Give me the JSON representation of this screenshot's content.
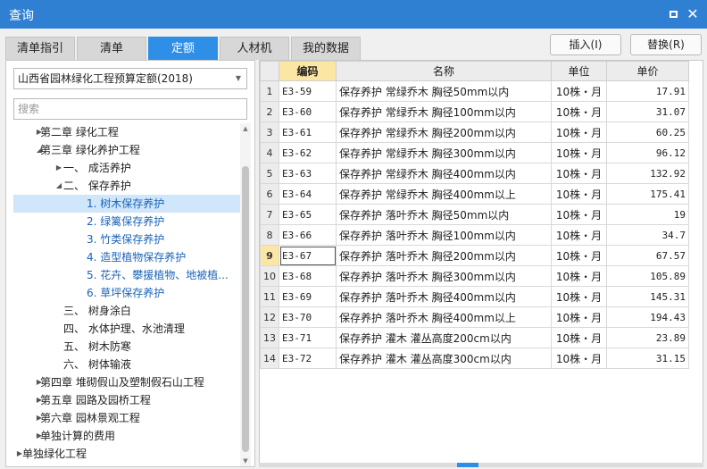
{
  "window": {
    "title": "查询",
    "minimize_icon": "restore-icon",
    "close_icon": "close-icon"
  },
  "tabs": [
    {
      "label": "清单指引"
    },
    {
      "label": "清单"
    },
    {
      "label": "定额"
    },
    {
      "label": "人材机"
    },
    {
      "label": "我的数据"
    }
  ],
  "active_tab": "定额",
  "actions": {
    "insert": "插入(I)",
    "replace": "替换(R)"
  },
  "left": {
    "library": "山西省园林绿化工程预算定额(2018)",
    "search_placeholder": "搜索",
    "tree": [
      {
        "label": "第二章 绿化工程",
        "caret": "right"
      },
      {
        "label": "第三章 绿化养护工程",
        "caret": "down"
      },
      {
        "label": "一、 成活养护",
        "caret": "right"
      },
      {
        "label": "二、 保存养护",
        "caret": "down"
      },
      {
        "label": "1. 树木保存养护",
        "caret": ""
      },
      {
        "label": "2. 绿篱保存养护",
        "caret": ""
      },
      {
        "label": "3. 竹类保存养护",
        "caret": ""
      },
      {
        "label": "4. 造型植物保存养护",
        "caret": ""
      },
      {
        "label": "5. 花卉、攀援植物、地被植...",
        "caret": ""
      },
      {
        "label": "6. 草坪保存养护",
        "caret": ""
      },
      {
        "label": "三、 树身涂白",
        "caret": ""
      },
      {
        "label": "四、 水体护理、水池清理",
        "caret": ""
      },
      {
        "label": "五、 树木防寒",
        "caret": ""
      },
      {
        "label": "六、 树体输液",
        "caret": ""
      },
      {
        "label": "第四章 堆砌假山及塑制假石山工程",
        "caret": "right"
      },
      {
        "label": "第五章 园路及园桥工程",
        "caret": "right"
      },
      {
        "label": "第六章 园林景观工程",
        "caret": "right"
      },
      {
        "label": "单独计算的费用",
        "caret": "right"
      },
      {
        "label": "单独绿化工程",
        "caret": "right"
      }
    ]
  },
  "grid": {
    "columns": [
      "编码",
      "名称",
      "单位",
      "单价"
    ],
    "rows": [
      {
        "n": "1",
        "code": "E3-59",
        "name": "保存养护 常绿乔木 胸径50mm以内",
        "unit": "10株・月",
        "price": "17.91"
      },
      {
        "n": "2",
        "code": "E3-60",
        "name": "保存养护 常绿乔木 胸径100mm以内",
        "unit": "10株・月",
        "price": "31.07"
      },
      {
        "n": "3",
        "code": "E3-61",
        "name": "保存养护 常绿乔木 胸径200mm以内",
        "unit": "10株・月",
        "price": "60.25"
      },
      {
        "n": "4",
        "code": "E3-62",
        "name": "保存养护 常绿乔木 胸径300mm以内",
        "unit": "10株・月",
        "price": "96.12"
      },
      {
        "n": "5",
        "code": "E3-63",
        "name": "保存养护 常绿乔木 胸径400mm以内",
        "unit": "10株・月",
        "price": "132.92"
      },
      {
        "n": "6",
        "code": "E3-64",
        "name": "保存养护 常绿乔木 胸径400mm以上",
        "unit": "10株・月",
        "price": "175.41"
      },
      {
        "n": "7",
        "code": "E3-65",
        "name": "保存养护 落叶乔木 胸径50mm以内",
        "unit": "10株・月",
        "price": "19"
      },
      {
        "n": "8",
        "code": "E3-66",
        "name": "保存养护 落叶乔木 胸径100mm以内",
        "unit": "10株・月",
        "price": "34.7"
      },
      {
        "n": "9",
        "code": "E3-67",
        "name": "保存养护 落叶乔木 胸径200mm以内",
        "unit": "10株・月",
        "price": "67.57"
      },
      {
        "n": "10",
        "code": "E3-68",
        "name": "保存养护 落叶乔木 胸径300mm以内",
        "unit": "10株・月",
        "price": "105.89"
      },
      {
        "n": "11",
        "code": "E3-69",
        "name": "保存养护 落叶乔木 胸径400mm以内",
        "unit": "10株・月",
        "price": "145.31"
      },
      {
        "n": "12",
        "code": "E3-70",
        "name": "保存养护 落叶乔木 胸径400mm以上",
        "unit": "10株・月",
        "price": "194.43"
      },
      {
        "n": "13",
        "code": "E3-71",
        "name": "保存养护 灌木 灌丛高度200cm以内",
        "unit": "10株・月",
        "price": "23.89"
      },
      {
        "n": "14",
        "code": "E3-72",
        "name": "保存养护 灌木 灌丛高度300cm以内",
        "unit": "10株・月",
        "price": "31.15"
      }
    ]
  },
  "colors": {
    "titlebar": "#2f7fd3",
    "tab_active": "#2f8ee5",
    "header_active": "#fbe6a4",
    "tree_selected": "#cfe6fb"
  }
}
